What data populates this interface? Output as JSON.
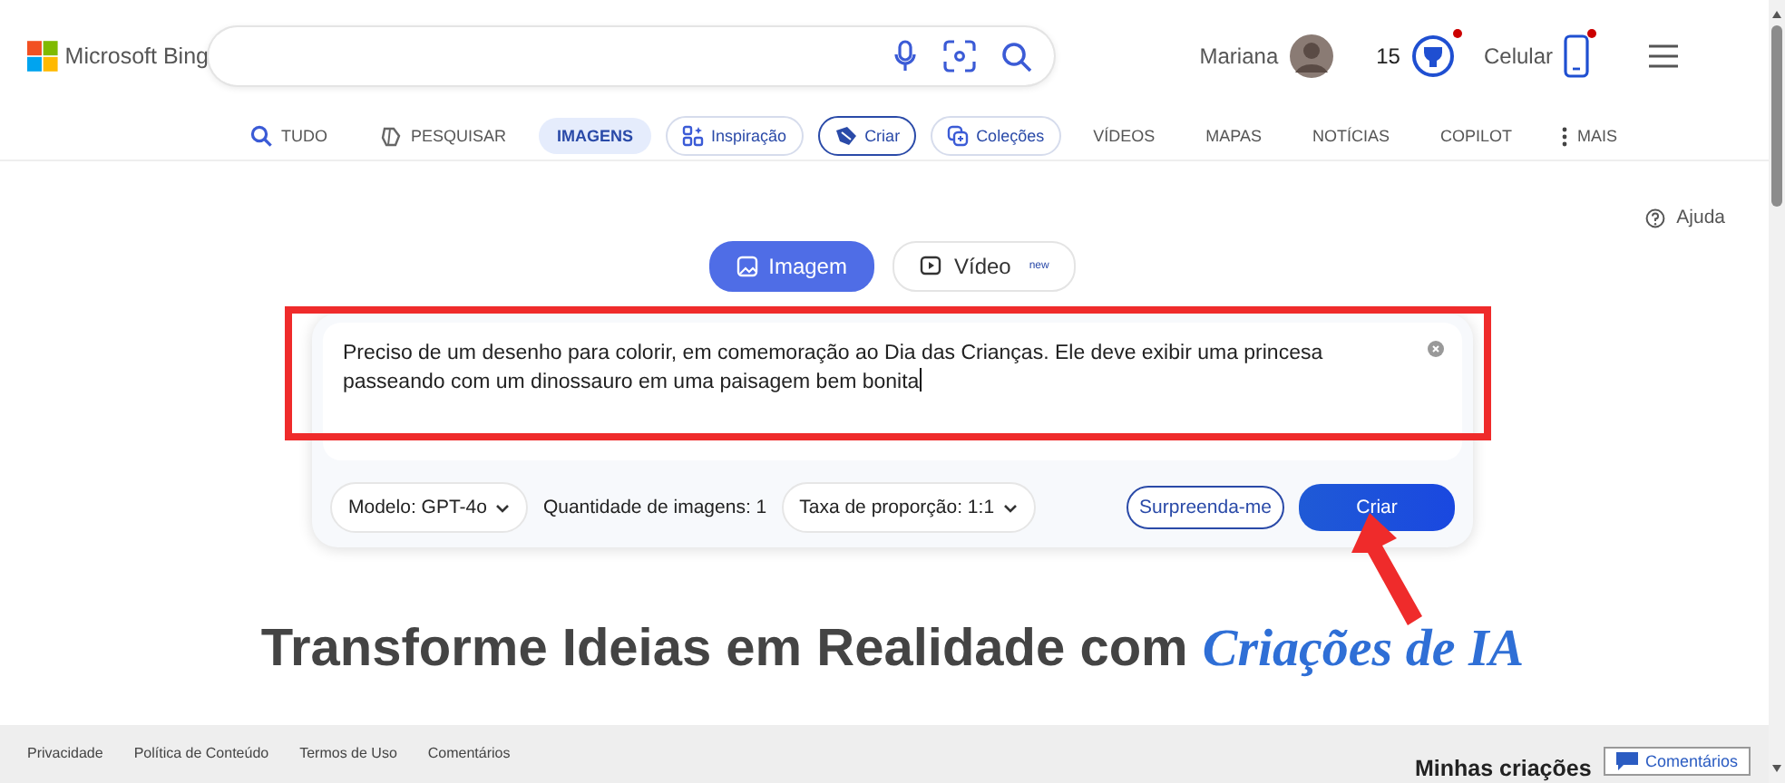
{
  "header": {
    "logo": "Microsoft Bing",
    "user": "Mariana",
    "points": "15",
    "phone_label": "Celular",
    "points_notice": true,
    "phone_notice": true
  },
  "nav": [
    {
      "label": "TUDO",
      "kind": "plain",
      "selected": false
    },
    {
      "label": "PESQUISAR",
      "kind": "plain",
      "selected": false
    },
    {
      "label": "IMAGENS",
      "kind": "plain",
      "selected": true
    },
    {
      "label": "Inspiração",
      "kind": "pill",
      "selected": false
    },
    {
      "label": "Criar",
      "kind": "pill",
      "selected": true
    },
    {
      "label": "Coleções",
      "kind": "pill",
      "selected": false
    },
    {
      "label": "VÍDEOS",
      "kind": "plain",
      "selected": false
    },
    {
      "label": "MAPAS",
      "kind": "plain",
      "selected": false
    },
    {
      "label": "NOTÍCIAS",
      "kind": "plain",
      "selected": false
    },
    {
      "label": "COPILOT",
      "kind": "plain",
      "selected": false
    },
    {
      "label": "MAIS",
      "kind": "plain",
      "selected": false
    }
  ],
  "help": "Ajuda",
  "modes": [
    {
      "label": "Imagem",
      "selected": true
    },
    {
      "label": "Vídeo",
      "badge": "new",
      "selected": false
    }
  ],
  "prompt": {
    "value": "Preciso de um desenho para colorir, em comemoração ao Dia das Crianças. Ele deve exibir uma princesa passeando com um dinossauro em uma paisagem bem bonita"
  },
  "options": [
    {
      "label": "Modelo: GPT-4o",
      "kind": "dropdown"
    },
    {
      "label": "Quantidade de imagens: 1",
      "kind": "text"
    },
    {
      "label": "Taxa de proporção: 1:1",
      "kind": "dropdown"
    }
  ],
  "actions": [
    {
      "label": "Surpreenda-me",
      "kind": "outline"
    },
    {
      "label": "Criar",
      "kind": "primary"
    }
  ],
  "headline": {
    "text": "Transforme Ideias em Realidade com ",
    "accent": "Criações de IA"
  },
  "footer": {
    "links": [
      "Privacidade",
      "Política de Conteúdo",
      "Termos de Uso",
      "Comentários"
    ],
    "feedback_button": "Comentários",
    "section_title": "Minhas criações"
  }
}
